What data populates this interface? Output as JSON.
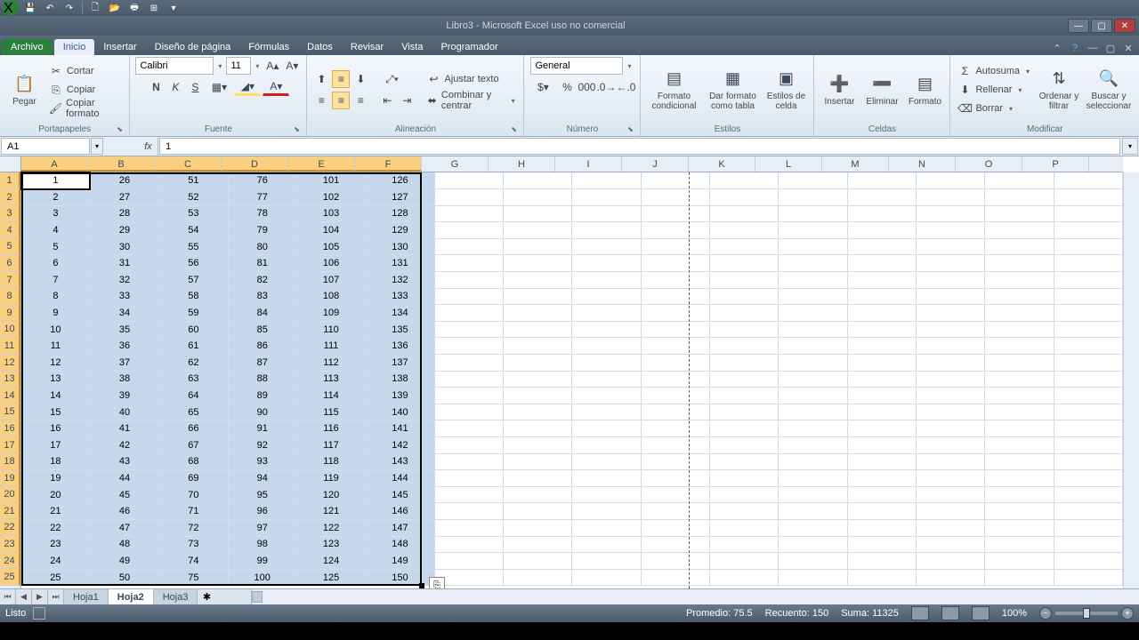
{
  "window": {
    "title": "Libro3 - Microsoft Excel uso no comercial"
  },
  "tabs": {
    "file": "Archivo",
    "items": [
      "Inicio",
      "Insertar",
      "Diseño de página",
      "Fórmulas",
      "Datos",
      "Revisar",
      "Vista",
      "Programador"
    ],
    "active": "Inicio"
  },
  "ribbon": {
    "clipboard": {
      "paste": "Pegar",
      "cut": "Cortar",
      "copy": "Copiar",
      "format_painter": "Copiar formato",
      "label": "Portapapeles"
    },
    "font": {
      "name": "Calibri",
      "size": "11",
      "label": "Fuente"
    },
    "alignment": {
      "wrap": "Ajustar texto",
      "merge": "Combinar y centrar",
      "label": "Alineación"
    },
    "number": {
      "format": "General",
      "label": "Número"
    },
    "styles": {
      "cond": "Formato condicional",
      "table": "Dar formato como tabla",
      "cell": "Estilos de celda",
      "label": "Estilos"
    },
    "cells": {
      "insert": "Insertar",
      "delete": "Eliminar",
      "format": "Formato",
      "label": "Celdas"
    },
    "editing": {
      "autosum": "Autosuma",
      "fill": "Rellenar",
      "clear": "Borrar",
      "sort": "Ordenar y filtrar",
      "find": "Buscar y seleccionar",
      "label": "Modificar"
    }
  },
  "namebox": "A1",
  "formula": "1",
  "columns": [
    "A",
    "B",
    "C",
    "D",
    "E",
    "F",
    "G",
    "H",
    "I",
    "J",
    "K",
    "L",
    "M",
    "N",
    "O",
    "P"
  ],
  "selected_cols": [
    "A",
    "B",
    "C",
    "D",
    "E",
    "F"
  ],
  "row_count": 25,
  "chart_data": {
    "type": "table",
    "columns": [
      "A",
      "B",
      "C",
      "D",
      "E",
      "F"
    ],
    "rows": [
      [
        1,
        26,
        51,
        76,
        101,
        126
      ],
      [
        2,
        27,
        52,
        77,
        102,
        127
      ],
      [
        3,
        28,
        53,
        78,
        103,
        128
      ],
      [
        4,
        29,
        54,
        79,
        104,
        129
      ],
      [
        5,
        30,
        55,
        80,
        105,
        130
      ],
      [
        6,
        31,
        56,
        81,
        106,
        131
      ],
      [
        7,
        32,
        57,
        82,
        107,
        132
      ],
      [
        8,
        33,
        58,
        83,
        108,
        133
      ],
      [
        9,
        34,
        59,
        84,
        109,
        134
      ],
      [
        10,
        35,
        60,
        85,
        110,
        135
      ],
      [
        11,
        36,
        61,
        86,
        111,
        136
      ],
      [
        12,
        37,
        62,
        87,
        112,
        137
      ],
      [
        13,
        38,
        63,
        88,
        113,
        138
      ],
      [
        14,
        39,
        64,
        89,
        114,
        139
      ],
      [
        15,
        40,
        65,
        90,
        115,
        140
      ],
      [
        16,
        41,
        66,
        91,
        116,
        141
      ],
      [
        17,
        42,
        67,
        92,
        117,
        142
      ],
      [
        18,
        43,
        68,
        93,
        118,
        143
      ],
      [
        19,
        44,
        69,
        94,
        119,
        144
      ],
      [
        20,
        45,
        70,
        95,
        120,
        145
      ],
      [
        21,
        46,
        71,
        96,
        121,
        146
      ],
      [
        22,
        47,
        72,
        97,
        122,
        147
      ],
      [
        23,
        48,
        73,
        98,
        123,
        148
      ],
      [
        24,
        49,
        74,
        99,
        124,
        149
      ],
      [
        25,
        50,
        75,
        100,
        125,
        150
      ]
    ]
  },
  "sheets": {
    "items": [
      "Hoja1",
      "Hoja2",
      "Hoja3"
    ],
    "active": "Hoja2"
  },
  "status": {
    "ready": "Listo",
    "avg_label": "Promedio:",
    "avg": "75.5",
    "count_label": "Recuento:",
    "count": "150",
    "sum_label": "Suma:",
    "sum": "11325",
    "zoom": "100%"
  }
}
